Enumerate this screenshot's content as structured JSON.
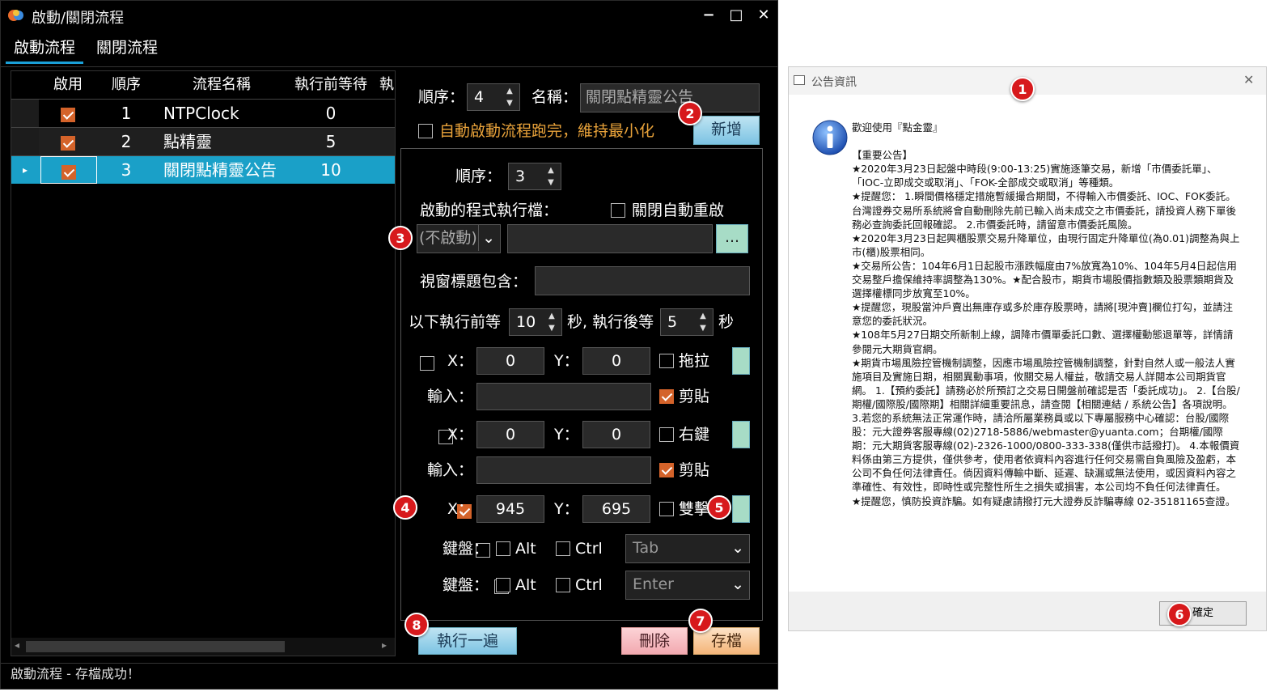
{
  "window": {
    "title": "啟動/關閉流程",
    "minimize": "−",
    "maximize": "□",
    "close": "✕"
  },
  "tabs": [
    {
      "label": "啟動流程"
    },
    {
      "label": "關閉流程"
    }
  ],
  "grid": {
    "headers": [
      "啟用",
      "順序",
      "流程名稱",
      "執行前等待",
      "執"
    ],
    "rows": [
      {
        "enabled": true,
        "order": "1",
        "name": "NTPClock",
        "wait": "0"
      },
      {
        "enabled": true,
        "order": "2",
        "name": "點精靈",
        "wait": "5"
      },
      {
        "enabled": true,
        "order": "3",
        "name": "關閉點精靈公告",
        "wait": "10",
        "selected": true
      }
    ],
    "scroll_left": "◂",
    "scroll_right": "▸",
    "row_pointer": "▸"
  },
  "top": {
    "order_label": "順序：",
    "order_value": "4",
    "name_label": "名稱：",
    "name_value": "關閉點精靈公告",
    "auto_label": "自動啟動流程跑完，維持最小化",
    "add_button": "新增"
  },
  "detail": {
    "order_label": "順序：",
    "order_value": "3",
    "exe_label": "啟動的程式執行檔：",
    "close_restart_label": "關閉自動重啟",
    "exe_combo": "(不啟動)",
    "browse": "...",
    "title_label": "視窗標題包含：",
    "wait_before_label": "以下執行前等",
    "wait_before_value": "10",
    "wait_after_label": "秒, 執行後等",
    "wait_after_value": "5",
    "sec_label": "秒",
    "x_label": "X：",
    "y_label": "Y：",
    "input_label": "輸入：",
    "row1": {
      "x": "0",
      "y": "0",
      "mode": "拖拉"
    },
    "paste1": "剪貼",
    "row2": {
      "x": "0",
      "y": "0",
      "mode": "右鍵"
    },
    "paste2": "剪貼",
    "row3": {
      "x": "945",
      "y": "695",
      "mode": "雙擊"
    },
    "kb_label": "鍵盤：",
    "alt": "Alt",
    "ctrl": "Ctrl",
    "key1": "Tab",
    "key2": "Enter"
  },
  "buttons": {
    "run_once": "執行一遍",
    "delete": "刪除",
    "save": "存檔"
  },
  "status": "啟動流程 - 存檔成功！",
  "dialog": {
    "title": "公告資訊",
    "close": "✕",
    "ok": "確定",
    "text": "歡迎使用『點金靈』\n\n【重要公告】\n★2020年3月23日起盤中時段(9:00-13:25)實施逐筆交易，新增「市價委託單」、「IOC-立即成交或取消」、「FOK-全部成交或取消」等種類。\n★提醒您： 1.瞬間價格穩定措施暫緩撮合期間，不得輸入市價委託、IOC、FOK委託。台灣證券交易所系統將會自動刪除先前已輸入尚未成交之市價委託，請投資人務下單後務必查詢委託回報確認。 2.市價委託時，請留意市價委託風險。\n★2020年3月23日起興櫃股票交易升降單位，由現行固定升降單位(為0.01)調整為與上市(櫃)股票相同。\n★交易所公告：104年6月1日起股市漲跌幅度由7%放寬為10%、104年5月4日起信用交易整戶擔保維持率調整為130%。★配合股市，期貨市場股價指數類及股票類期貨及選擇權標同步放寬至10%。\n★提醒您，現股當沖戶賣出無庫存或多於庫存股票時，請將[現沖賣]欄位打勾，並請注意您的委託狀況。\n★108年5月27日期交所新制上線，調降市價單委託口數、選擇權動態退單等，詳情請參閱元大期貨官網。\n★期貨市場風險控管機制調整，因應市場風險控管機制調整，針對自然人或一般法人實施項目及實施日期，相關異動事項，攸關交易人權益，敬請交易人詳閱本公司期貨官網。 1.【預約委託】請務必於所預訂之交易日開盤前確認是否「委託成功」。 2.【台股/期權/國際股/國際期】相關詳細重要訊息，請查閱【相關連結 / 系統公告】各項說明。 3.若您的系統無法正常運作時，請洽所屬業務員或以下專屬服務中心確認：台股/國際股：元大證券客服專線(02)2718-5886/webmaster@yuanta.com；台期權/國際期：元大期貨客服專線(02)-2326-1000/0800-333-338(僅供市話撥打)。 4.本報價資料係由第三方提供，僅供參考，使用者依資料內容進行任何交易需自負風險及盈虧，本公司不負任何法律責任。倘因資料傳輸中斷、延遲、缺漏或無法使用，或因資料內容之準確性、有效性，即時性或完整性所生之損失或損害，本公司均不負任何法律責任。\n★提醒您，慎防投資詐騙。如有疑慮請撥打元大證券反詐騙專線 02-35181165查證。"
  },
  "badges": [
    "1",
    "2",
    "3",
    "4",
    "5",
    "6",
    "7",
    "8"
  ],
  "colors": {
    "selection": "#1aa0c8",
    "checkbox": "#d4632a",
    "badge": "#d7191c",
    "orange_text": "#e8a23a"
  }
}
